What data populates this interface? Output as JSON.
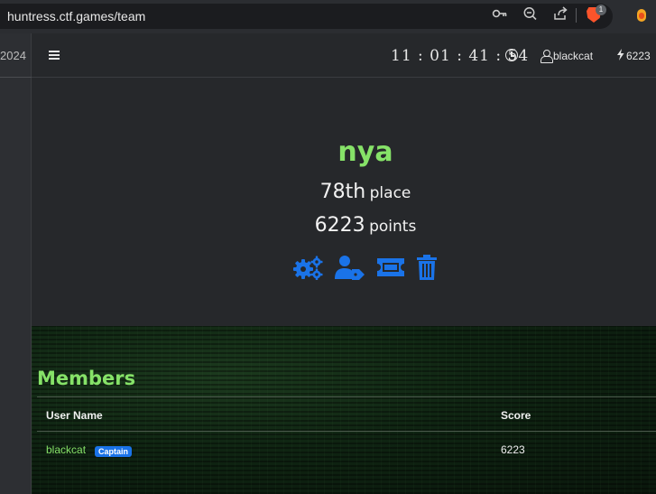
{
  "browser": {
    "url": "huntress.ctf.games/team",
    "extension_badge": "1"
  },
  "sidebar": {
    "year_fragment": "2024"
  },
  "navbar": {
    "clock": "11 : 01 : 41 : 54",
    "username": "blackcat",
    "points": "6223"
  },
  "team": {
    "name": "nya",
    "place_value": "78th",
    "place_label": "place",
    "points_value": "6223",
    "points_label": "points",
    "actions": [
      "settings-gears",
      "user-tag",
      "ticket",
      "trash"
    ]
  },
  "members": {
    "title": "Members",
    "columns": [
      "User Name",
      "Score"
    ],
    "rows": [
      {
        "name": "blackcat",
        "badge": "Captain",
        "score": "6223"
      }
    ]
  },
  "colors": {
    "accent_green": "#86e268",
    "action_blue": "#1a73e8",
    "page_bg": "#26282b"
  }
}
